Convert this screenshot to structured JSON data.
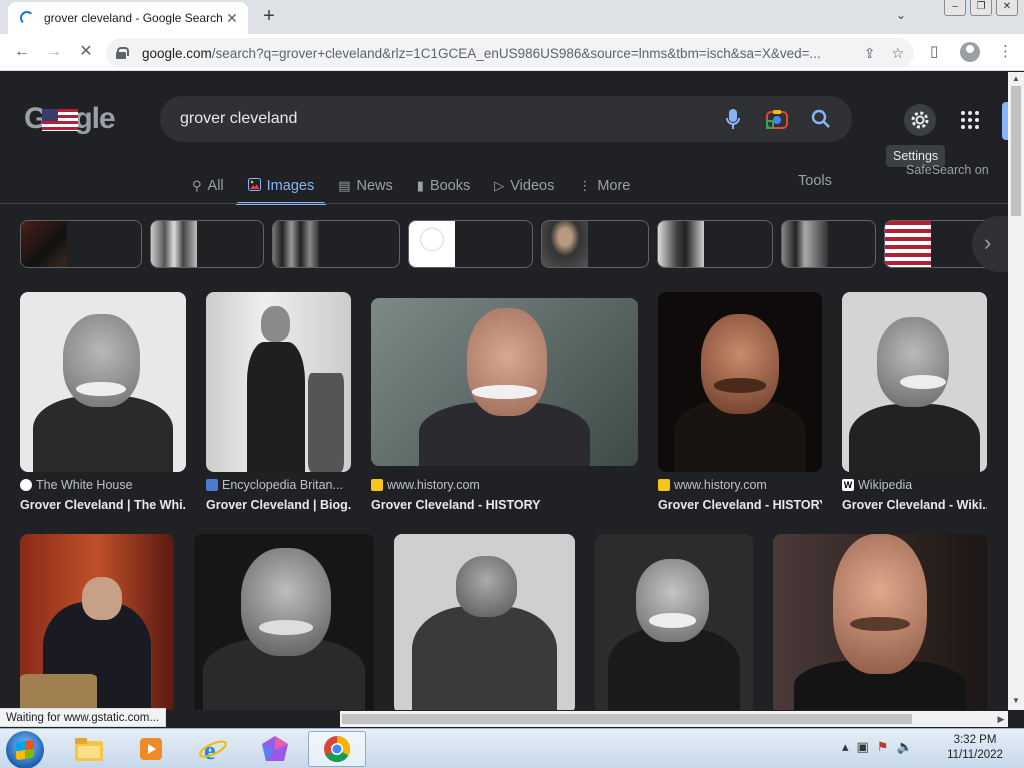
{
  "browser": {
    "tab_title": "grover cleveland - Google Search",
    "tab_close": "✕",
    "new_tab": "+",
    "url_host": "google.com",
    "url_rest": "/search?q=grover+cleveland&rlz=1C1GCEA_enUS986US986&source=lnms&tbm=isch&sa=X&ved=...",
    "status_text": "Waiting for www.gstatic.com..."
  },
  "google": {
    "logo_pre": "G",
    "logo_post": "gle",
    "query": "grover cleveland",
    "settings_tooltip": "Settings",
    "safesearch_text": "SafeSearch on",
    "tabs": [
      {
        "label": "All",
        "icon": "search-icon"
      },
      {
        "label": "Images",
        "icon": "image-icon"
      },
      {
        "label": "News",
        "icon": "news-icon"
      },
      {
        "label": "Books",
        "icon": "book-icon"
      },
      {
        "label": "Videos",
        "icon": "video-icon"
      },
      {
        "label": "More",
        "icon": "more-vert-icon"
      }
    ],
    "tools_label": "Tools"
  },
  "results_row1": [
    {
      "source": "The White House",
      "caption": "Grover Cleveland | The Whi..."
    },
    {
      "source": "Encyclopedia Britan...",
      "caption": "Grover Cleveland | Biog..."
    },
    {
      "source": "www.history.com",
      "caption": "Grover Cleveland - HISTORY"
    },
    {
      "source": "www.history.com",
      "caption": "Grover Cleveland - HISTORY"
    },
    {
      "source": "Wikipedia",
      "caption": "Grover Cleveland - Wiki..."
    }
  ],
  "taskbar": {
    "time": "3:32 PM",
    "date": "11/11/2022"
  },
  "colors": {
    "page_bg": "#202124",
    "accent": "#8ab4f8",
    "searchbox_bg": "#303134"
  }
}
